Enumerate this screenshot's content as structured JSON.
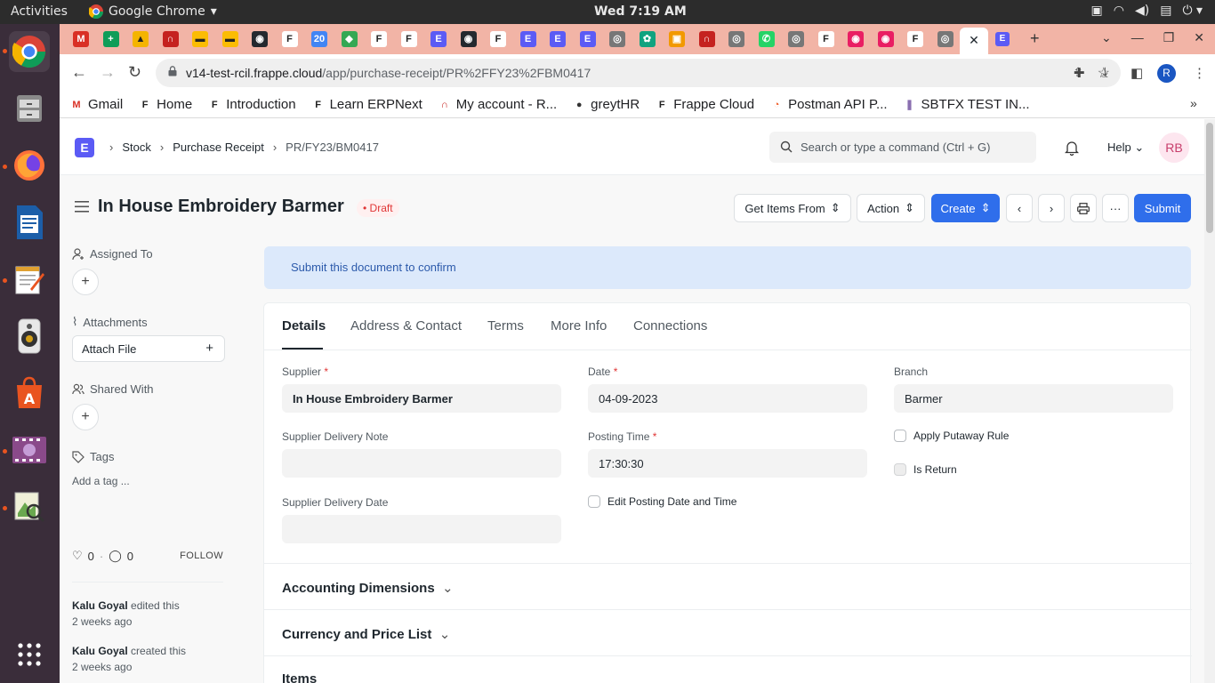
{
  "os": {
    "activities": "Activities",
    "app_name": "Google Chrome",
    "clock": "Wed  7:19 AM"
  },
  "browser": {
    "url_host": "v14-test-rcil.frappe.cloud",
    "url_path": "/app/purchase-receipt/PR%2FFY23%2FBM0417",
    "bookmarks": [
      {
        "label": "Gmail",
        "icon": "gmail-icon"
      },
      {
        "label": "Home",
        "icon": "frappe-icon"
      },
      {
        "label": "Introduction",
        "icon": "frappe-icon"
      },
      {
        "label": "Learn ERPNext",
        "icon": "frappe-icon"
      },
      {
        "label": "My account - R...",
        "icon": "arc-icon"
      },
      {
        "label": "greytHR",
        "icon": "globe-icon"
      },
      {
        "label": "Frappe Cloud",
        "icon": "frappe-icon"
      },
      {
        "label": "Postman API P...",
        "icon": "postman-icon"
      },
      {
        "label": "SBTFX TEST IN...",
        "icon": "sbtfx-icon"
      }
    ],
    "profile_initial": "R"
  },
  "navbar": {
    "breadcrumbs": [
      "Stock",
      "Purchase Receipt",
      "PR/FY23/BM0417"
    ],
    "search_placeholder": "Search or type a command (Ctrl + G)",
    "help": "Help",
    "avatar": "RB"
  },
  "doc": {
    "title": "In House Embroidery Barmer",
    "status": "Draft",
    "buttons": {
      "get_items": "Get Items From",
      "action": "Action",
      "create": "Create",
      "submit": "Submit"
    }
  },
  "sidebar": {
    "assigned_to": "Assigned To",
    "attachments": "Attachments",
    "attach_file": "Attach File",
    "shared_with": "Shared With",
    "tags": "Tags",
    "add_tag": "Add a tag ...",
    "likes": "0",
    "comments": "0",
    "follow": "FOLLOW",
    "activity": [
      {
        "user": "Kalu Goyal",
        "action": " edited this",
        "when": "2 weeks ago"
      },
      {
        "user": "Kalu Goyal",
        "action": " created this",
        "when": "2 weeks ago"
      }
    ]
  },
  "alert": "Submit this document to confirm",
  "tabs": [
    "Details",
    "Address & Contact",
    "Terms",
    "More Info",
    "Connections"
  ],
  "fields": {
    "supplier": {
      "label": "Supplier",
      "value": "In House Embroidery Barmer"
    },
    "date": {
      "label": "Date",
      "value": "04-09-2023"
    },
    "branch": {
      "label": "Branch",
      "value": "Barmer"
    },
    "supplier_delivery_note": {
      "label": "Supplier Delivery Note",
      "value": ""
    },
    "posting_time": {
      "label": "Posting Time",
      "value": "17:30:30"
    },
    "apply_putaway_rule": {
      "label": "Apply Putaway Rule",
      "checked": false
    },
    "is_return": {
      "label": "Is Return",
      "checked": false
    },
    "supplier_delivery_date": {
      "label": "Supplier Delivery Date",
      "value": ""
    },
    "edit_posting": {
      "label": "Edit Posting Date and Time",
      "checked": false
    }
  },
  "sections": [
    "Accounting Dimensions",
    "Currency and Price List",
    "Items"
  ],
  "colors": {
    "primary": "#2f6eeb",
    "draft": "#e03636",
    "tabbar": "#f2b4a6",
    "dock": "#3a2d3a"
  }
}
